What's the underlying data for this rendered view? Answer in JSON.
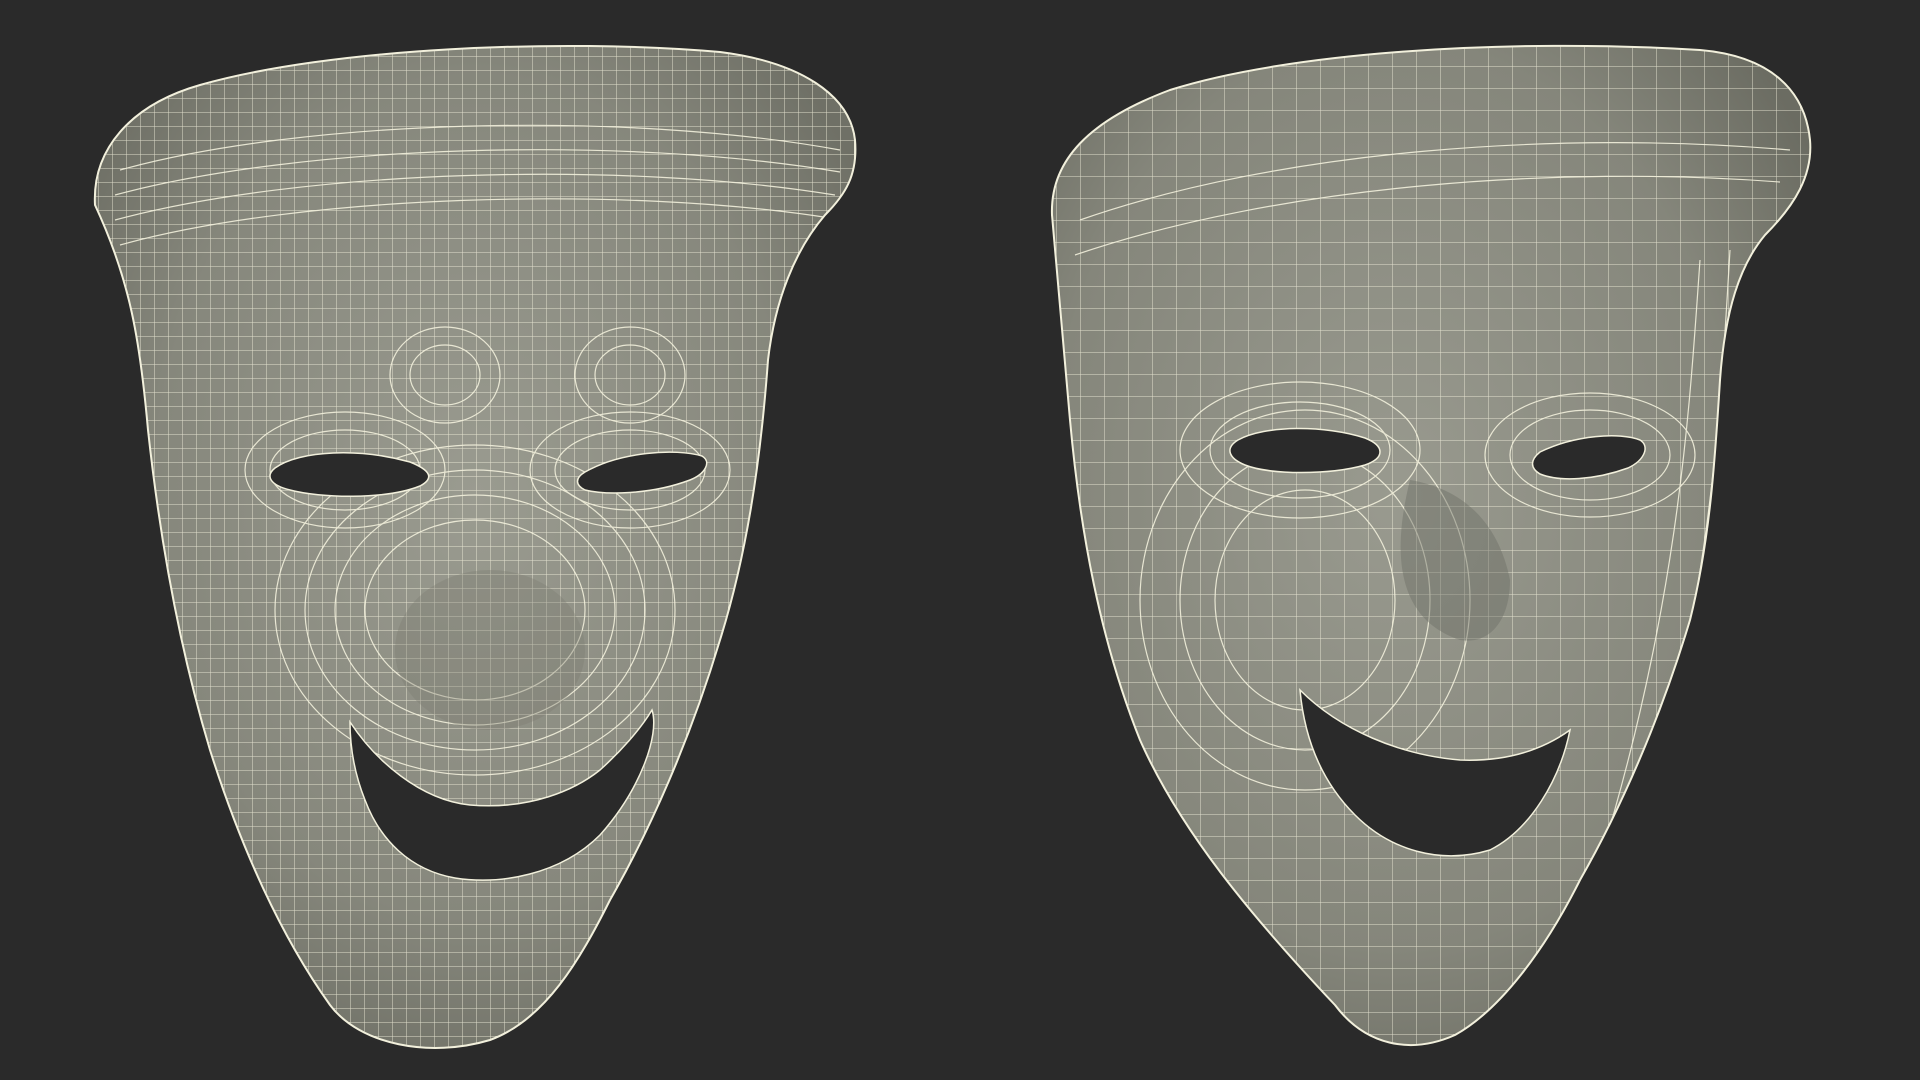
{
  "scene": {
    "background_color": "#2a2a2a",
    "mesh_surface_color": "#8a8b80",
    "wireframe_color": "#f2f0dc",
    "hole_color": "#2a2a2a",
    "objects": [
      {
        "name": "comedy-mask-wireframe-front",
        "expression": "smiling"
      },
      {
        "name": "comedy-mask-wireframe-angled",
        "expression": "smiling"
      }
    ]
  }
}
